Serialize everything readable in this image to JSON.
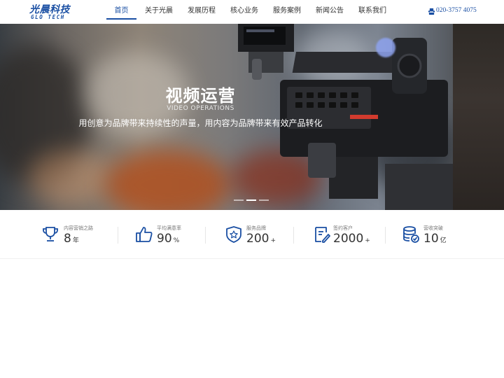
{
  "logo": {
    "cn": "光晨科技",
    "en": "GLO TECH"
  },
  "nav": {
    "items": [
      {
        "label": "首页",
        "active": true
      },
      {
        "label": "关于光晨",
        "active": false
      },
      {
        "label": "发展历程",
        "active": false
      },
      {
        "label": "核心业务",
        "active": false
      },
      {
        "label": "服务案例",
        "active": false
      },
      {
        "label": "新闻公告",
        "active": false
      },
      {
        "label": "联系我们",
        "active": false
      }
    ]
  },
  "phone": {
    "icon": "phone-icon",
    "number": "020-3757 4075"
  },
  "banner": {
    "title": "视频运营",
    "subtitle": "VIDEO OPERATIONS",
    "description": "用创意为品牌带来持续性的声量，用内容为品牌带来有效产品转化",
    "slide_count": 3,
    "active_slide": 2
  },
  "stats": [
    {
      "icon": "trophy-icon",
      "label": "内容营销之路",
      "value": "8",
      "unit": "年"
    },
    {
      "icon": "thumbs-up-icon",
      "label": "平均满意率",
      "value": "90",
      "unit": "%"
    },
    {
      "icon": "shield-star-icon",
      "label": "服务品牌",
      "value": "200",
      "unit": "+"
    },
    {
      "icon": "signed-document-icon",
      "label": "签约客户",
      "value": "2000",
      "unit": "+"
    },
    {
      "icon": "database-check-icon",
      "label": "营收突破",
      "value": "10",
      "unit": "亿"
    }
  ],
  "colors": {
    "brand": "#1a4fa3",
    "accent_blue": "#8ea3ef"
  }
}
